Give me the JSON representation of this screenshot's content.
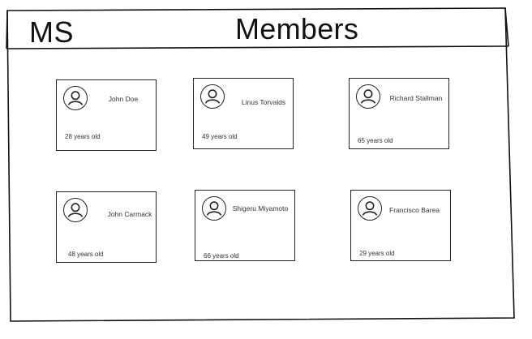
{
  "header": {
    "logo": "MS",
    "title": "Members"
  },
  "members": [
    {
      "name": "John Doe",
      "age": "28 years old",
      "avatar_icon": "user-circle-icon"
    },
    {
      "name": "Linus Torvalds",
      "age": "49 years old",
      "avatar_icon": "user-circle-icon"
    },
    {
      "name": "Richard Stallman",
      "age": "65 years old",
      "avatar_icon": "user-circle-icon"
    },
    {
      "name": "John Carmack",
      "age": "48 years old",
      "avatar_icon": "user-circle-icon"
    },
    {
      "name": "Shigeru Miyamoto",
      "age": "66 years old",
      "avatar_icon": "user-circle-icon"
    },
    {
      "name": "Francisco Barea",
      "age": "29 years old",
      "avatar_icon": "user-circle-icon"
    }
  ],
  "colors": {
    "ink": "#111111",
    "card_border": "#222222",
    "background": "#ffffff"
  }
}
